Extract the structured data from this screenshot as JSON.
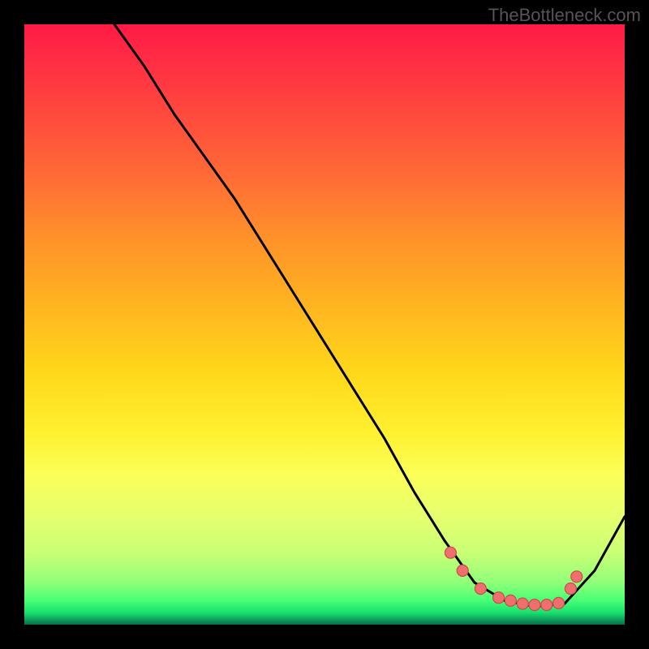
{
  "watermark": "TheBottleneck.com",
  "chart_data": {
    "type": "line",
    "title": "",
    "xlabel": "",
    "ylabel": "",
    "xlim": [
      0,
      100
    ],
    "ylim": [
      0,
      100
    ],
    "series": [
      {
        "name": "curve",
        "x": [
          15,
          20,
          25,
          30,
          35,
          40,
          45,
          50,
          55,
          60,
          65,
          70,
          75,
          80,
          85,
          90,
          95,
          100
        ],
        "y": [
          100,
          93,
          85,
          78,
          71,
          63,
          55,
          47,
          39,
          31,
          22,
          14,
          7,
          4,
          3,
          3.5,
          9,
          18
        ]
      }
    ],
    "markers": {
      "name": "dots",
      "x": [
        71,
        73,
        76,
        79,
        81,
        83,
        85,
        87,
        89,
        91,
        92
      ],
      "y": [
        12,
        9,
        6,
        4.5,
        4,
        3.5,
        3.3,
        3.3,
        3.6,
        6,
        8
      ]
    }
  }
}
